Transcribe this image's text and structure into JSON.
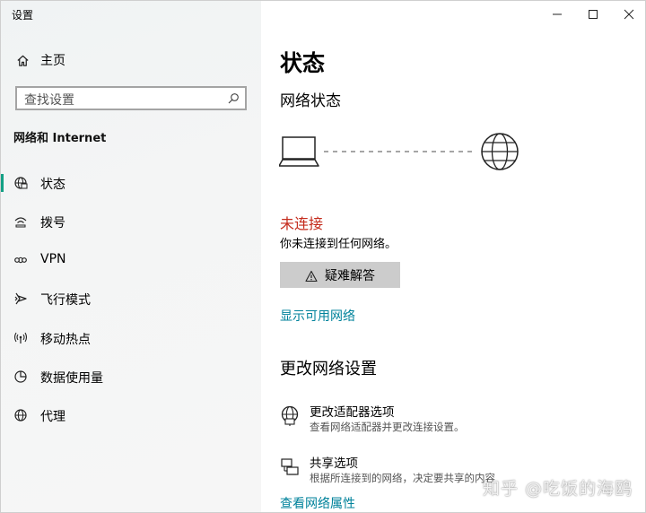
{
  "app": {
    "title": "设置"
  },
  "window_controls": {
    "minimize_icon": "minimize-icon",
    "maximize_icon": "maximize-icon",
    "close_icon": "close-icon"
  },
  "sidebar": {
    "home_label": "主页",
    "search_placeholder": "查找设置",
    "section_title": "网络和 Internet",
    "items": [
      {
        "label": "状态",
        "icon": "status-globe-icon",
        "active": true
      },
      {
        "label": "拨号",
        "icon": "dialup-icon",
        "active": false
      },
      {
        "label": "VPN",
        "icon": "vpn-icon",
        "active": false
      },
      {
        "label": "飞行模式",
        "icon": "airplane-icon",
        "active": false
      },
      {
        "label": "移动热点",
        "icon": "hotspot-icon",
        "active": false
      },
      {
        "label": "数据使用量",
        "icon": "data-usage-icon",
        "active": false
      },
      {
        "label": "代理",
        "icon": "proxy-globe-icon",
        "active": false
      }
    ]
  },
  "main": {
    "title": "状态",
    "network_status_title": "网络状态",
    "connection_status": "未连接",
    "connection_desc": "你未连接到任何网络。",
    "troubleshoot_label": "疑难解答",
    "show_networks_link": "显示可用网络",
    "change_settings_title": "更改网络设置",
    "options": [
      {
        "title": "更改适配器选项",
        "desc": "查看网络适配器并更改连接设置。",
        "icon": "adapter-globe-icon"
      },
      {
        "title": "共享选项",
        "desc": "根据所连接到的网络，决定要共享的内容",
        "icon": "sharing-icon"
      }
    ],
    "view_properties_link": "查看网络属性"
  },
  "watermark": "知乎 @吃饭的海鸥",
  "colors": {
    "accent": "#14a085",
    "link": "#00829b",
    "error": "#c42b1c",
    "button_bg": "#cccccc"
  }
}
